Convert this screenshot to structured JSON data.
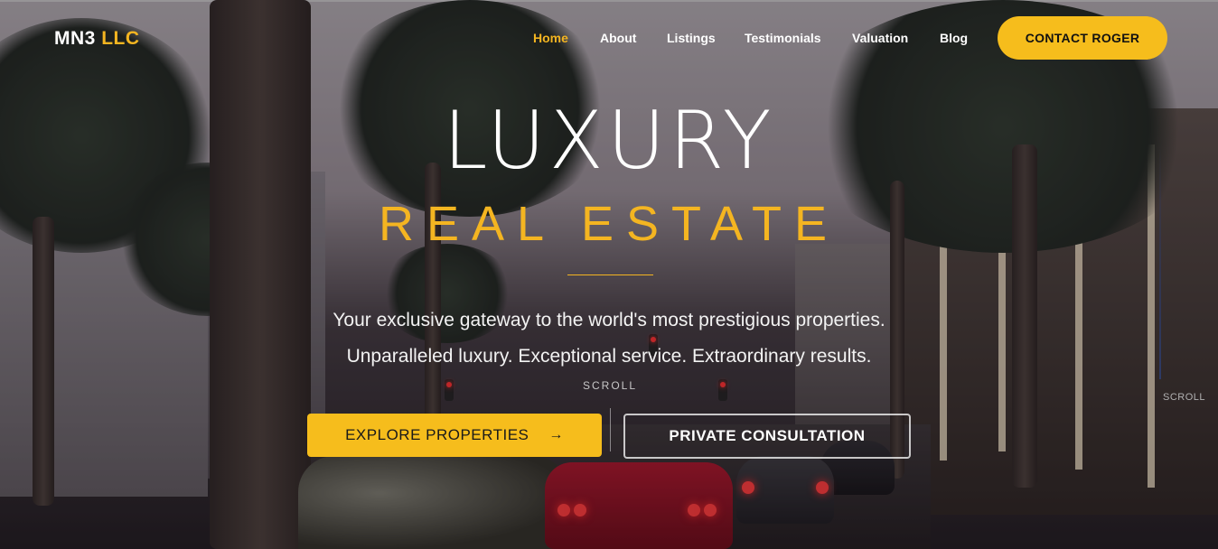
{
  "brand": {
    "name": "MN3",
    "suffix": "LLC"
  },
  "nav": {
    "items": [
      {
        "label": "Home",
        "active": true
      },
      {
        "label": "About"
      },
      {
        "label": "Listings"
      },
      {
        "label": "Testimonials"
      },
      {
        "label": "Valuation"
      },
      {
        "label": "Blog"
      }
    ],
    "cta_label": "CONTACT ROGER"
  },
  "hero": {
    "title": "LUXURY",
    "subtitle": "REAL ESTATE",
    "tagline_1": "Your exclusive gateway to the world's most prestigious properties.",
    "tagline_2": "Unparalleled luxury. Exceptional service. Extraordinary results.",
    "scroll_label": "SCROLL",
    "scroll_label_side": "SCROLL",
    "primary_button": "EXPLORE PROPERTIES",
    "primary_icon": "arrow-right-icon",
    "secondary_button": "PRIVATE CONSULTATION"
  },
  "colors": {
    "accent": "#f6bd1c",
    "text": "#ffffff"
  }
}
